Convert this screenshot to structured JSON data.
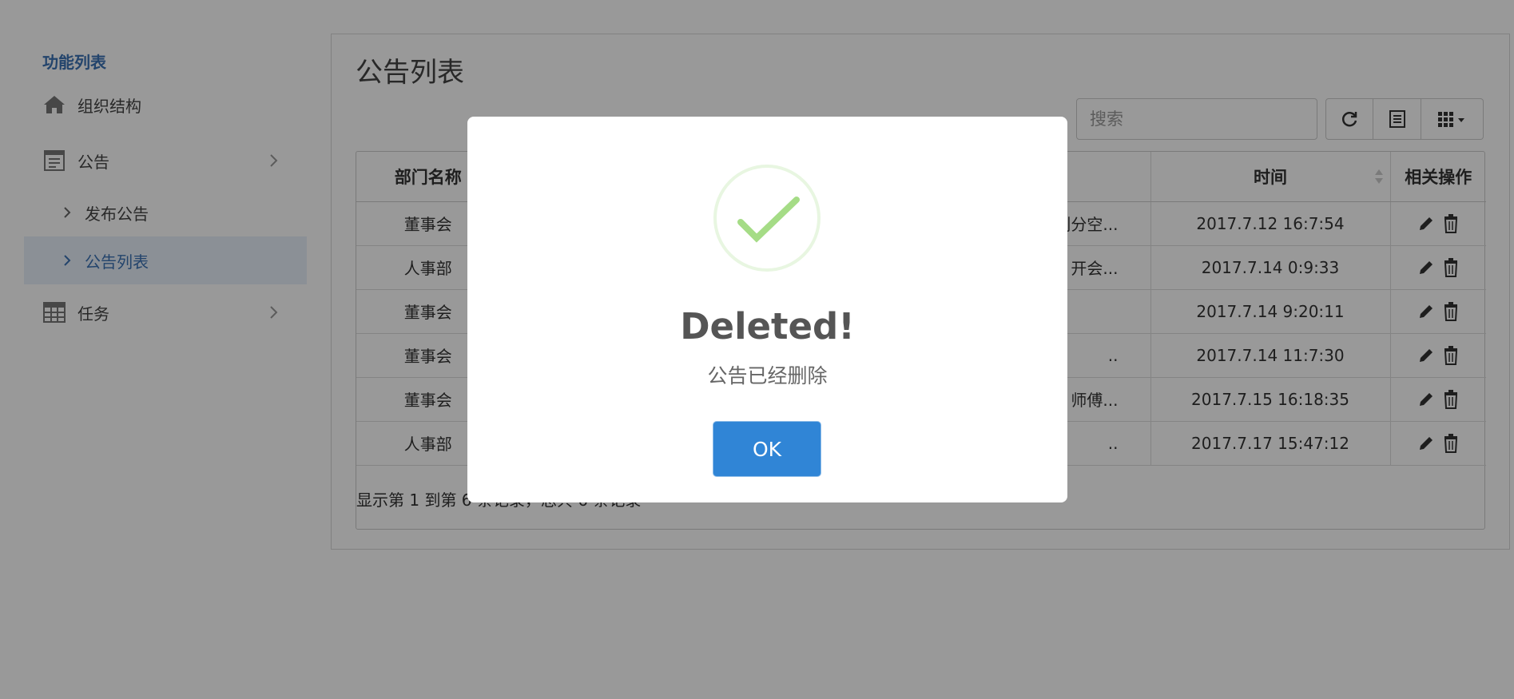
{
  "sidebar": {
    "title": "功能列表",
    "items": [
      {
        "label": "组织结构",
        "icon": "home-icon"
      },
      {
        "label": "公告",
        "icon": "notice-icon"
      },
      {
        "label": "发布公告"
      },
      {
        "label": "公告列表"
      },
      {
        "label": "任务",
        "icon": "table-icon"
      }
    ]
  },
  "main": {
    "title": "公告列表",
    "search_placeholder": "搜索",
    "table": {
      "headers": [
        "部门名称",
        "",
        "时间",
        "相关操作"
      ],
      "rows": [
        {
          "dept": "董事会",
          "mid": "划分空...",
          "time": "2017.7.12 16:7:54"
        },
        {
          "dept": "人事部",
          "mid": "开会...",
          "time": "2017.7.14 0:9:33"
        },
        {
          "dept": "董事会",
          "mid": "",
          "time": "2017.7.14 9:20:11"
        },
        {
          "dept": "董事会",
          "mid": "..",
          "time": "2017.7.14 11:7:30"
        },
        {
          "dept": "董事会",
          "mid": "师傅...",
          "time": "2017.7.15 16:18:35"
        },
        {
          "dept": "人事部",
          "mid": "..",
          "time": "2017.7.17 15:47:12"
        }
      ]
    },
    "footer": "显示第 1 到第 6 条记录，总共 6 条记录"
  },
  "modal": {
    "title": "Deleted!",
    "text": "公告已经删除",
    "ok_label": "OK",
    "success_color": "#a5dc86",
    "button_color": "#3085d6"
  }
}
